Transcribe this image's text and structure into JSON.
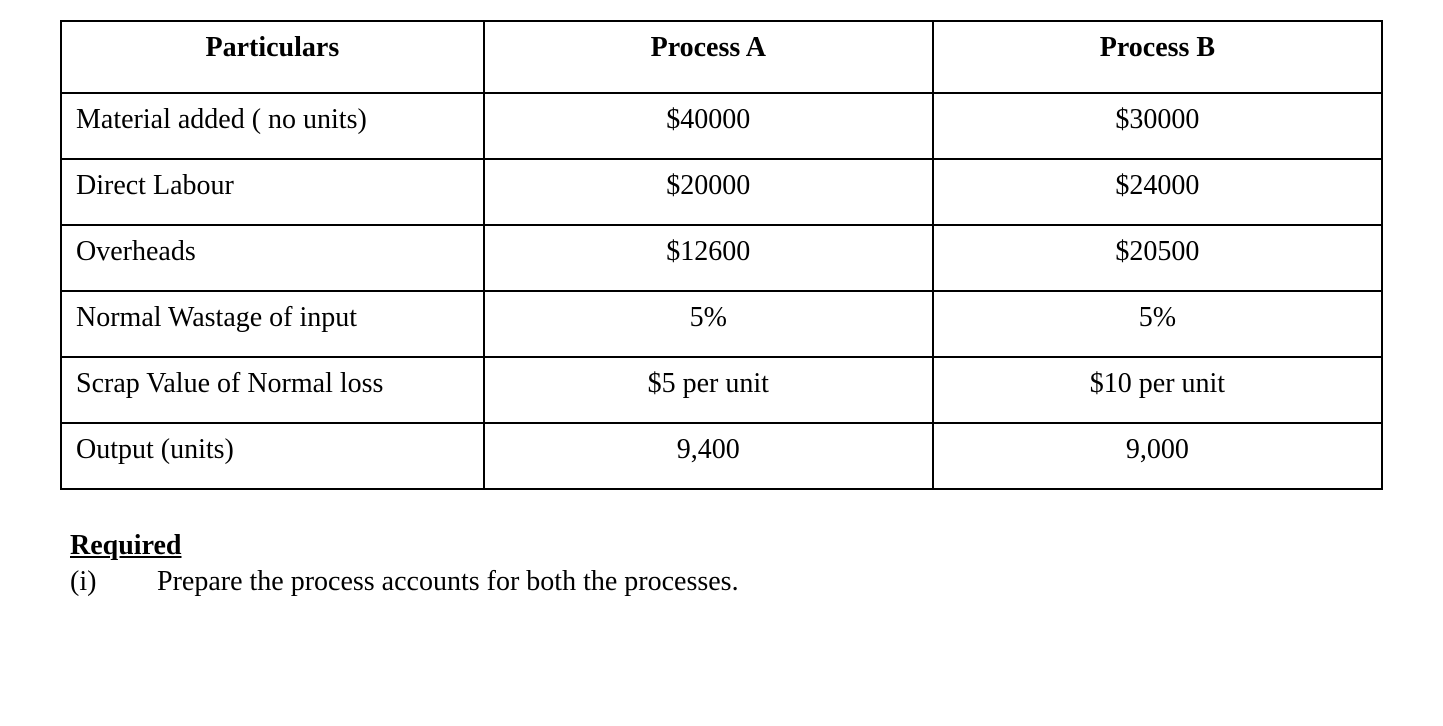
{
  "table": {
    "headers": [
      "Particulars",
      "Process A",
      "Process B"
    ],
    "rows": [
      {
        "label": "Material added ( no units)",
        "a": "$40000",
        "b": "$30000"
      },
      {
        "label": "Direct Labour",
        "a": "$20000",
        "b": "$24000"
      },
      {
        "label": "Overheads",
        "a": "$12600",
        "b": "$20500"
      },
      {
        "label": "Normal Wastage of input",
        "a": "5%",
        "b": "5%"
      },
      {
        "label": "Scrap Value of Normal loss",
        "a": "$5 per unit",
        "b": "$10 per unit"
      },
      {
        "label": "Output (units)",
        "a": "9,400",
        "b": "9,000"
      }
    ]
  },
  "required": {
    "heading": "Required",
    "item_number": "(i)",
    "item_text": "Prepare the process accounts for both the processes."
  }
}
